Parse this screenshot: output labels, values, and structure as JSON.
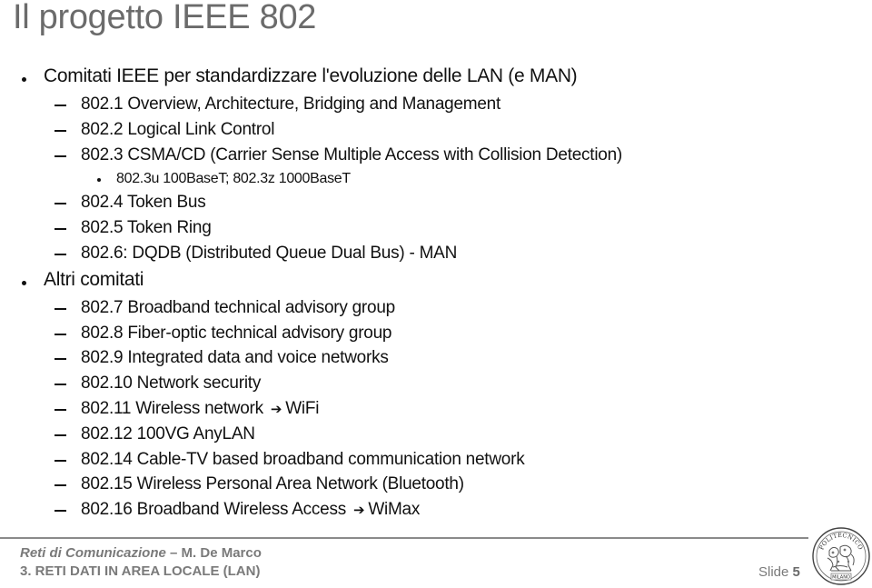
{
  "slide": {
    "title": "Il progetto IEEE 802",
    "bullets": [
      {
        "text": "Comitati IEEE per standardizzare l'evoluzione delle LAN (e MAN)",
        "children": [
          {
            "text": "802.1 Overview, Architecture, Bridging and Management"
          },
          {
            "text": "802.2 Logical Link Control"
          },
          {
            "text": "802.3 CSMA/CD (Carrier Sense Multiple Access with Collision Detection)",
            "children": [
              {
                "text": "802.3u 100BaseT; 802.3z 1000BaseT"
              }
            ]
          },
          {
            "text": "802.4 Token Bus"
          },
          {
            "text": "802.5 Token Ring"
          },
          {
            "text": "802.6: DQDB (Distributed Queue Dual Bus) - MAN"
          }
        ]
      },
      {
        "text": "Altri comitati",
        "children": [
          {
            "text": "802.7 Broadband technical advisory group"
          },
          {
            "text": "802.8 Fiber-optic technical advisory group"
          },
          {
            "text": "802.9 Integrated data and voice networks"
          },
          {
            "text": "802.10 Network security"
          },
          {
            "text": "802.11 Wireless network",
            "arrow": "right-arrow-icon",
            "after_arrow": "WiFi"
          },
          {
            "text": "802.12 100VG AnyLAN"
          },
          {
            "text": "802.14 Cable-TV based broadband communication network"
          },
          {
            "text": "802.15 Wireless Personal Area Network (Bluetooth)"
          },
          {
            "text": "802.16 Broadband Wireless Access",
            "arrow": "right-arrow-icon",
            "after_arrow": "WiMax"
          }
        ]
      }
    ]
  },
  "icons": {
    "arrow_glyph": "➔"
  },
  "footer": {
    "course": "Reti di Comunicazione",
    "separator": " – ",
    "author": "M. De Marco",
    "chapter": "3. RETI DATI IN AREA LOCALE (LAN)",
    "slide_label": "Slide ",
    "slide_number": "5",
    "logo_top_text": "POLITECNICO",
    "logo_bottom_text": "MILANO"
  },
  "colors": {
    "title": "#6b6b6b",
    "body_text": "#111111",
    "footer_text": "#7a7a7a",
    "footer_rule": "#8a8a8a"
  }
}
